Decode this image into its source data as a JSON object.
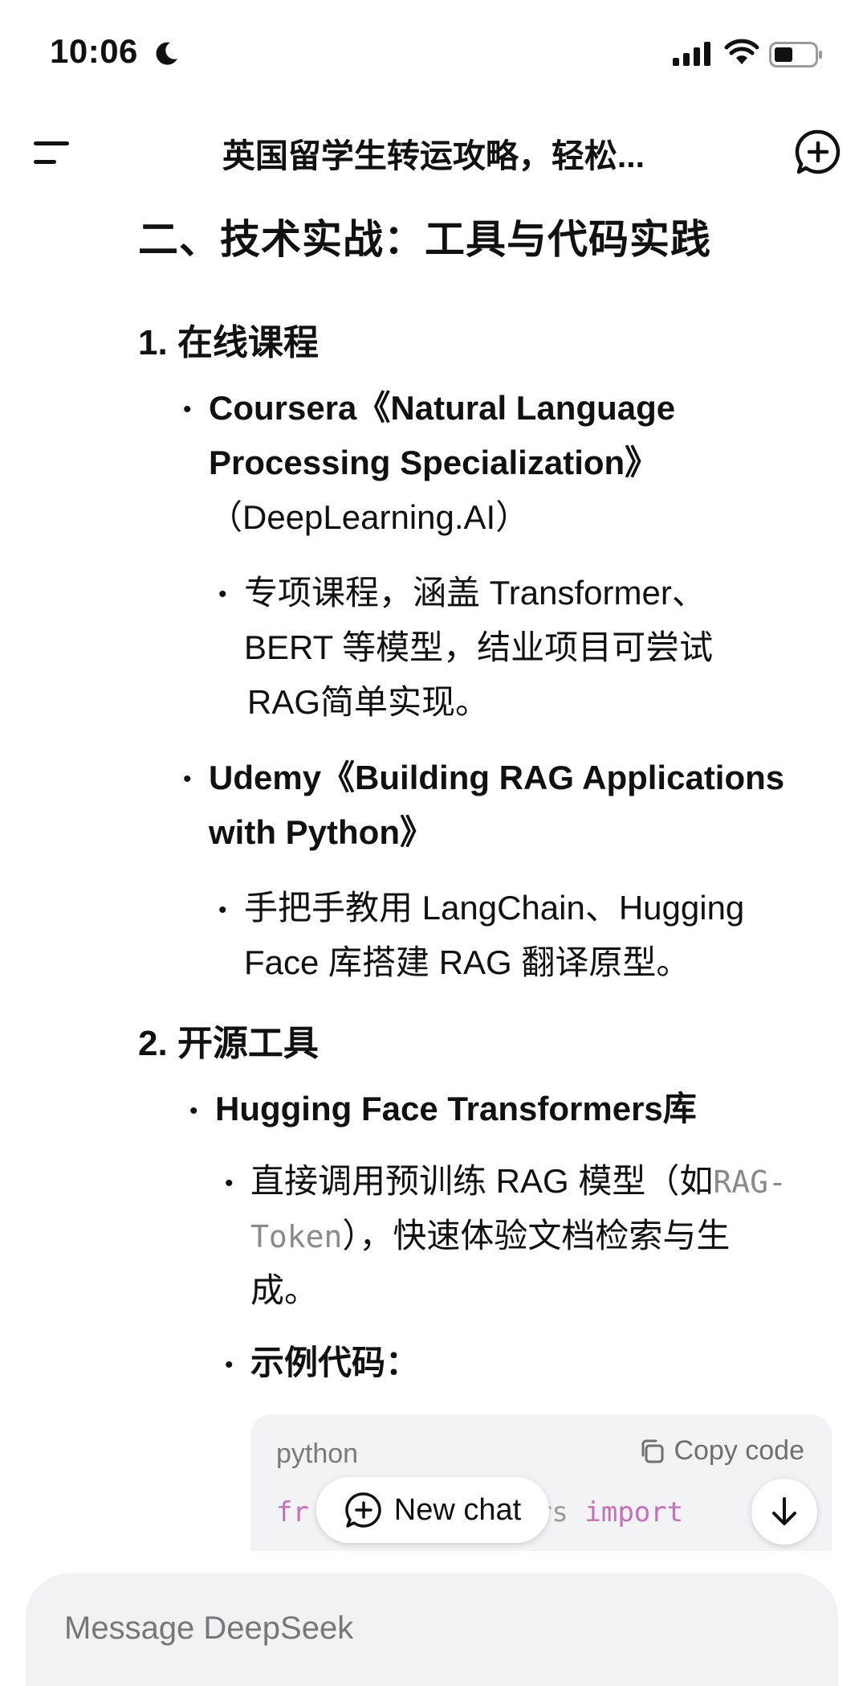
{
  "status_bar": {
    "time": "10:06"
  },
  "nav": {
    "title": "英国留学生转运攻略，轻松..."
  },
  "content": {
    "section_title": "二、技术实战：工具与代码实践",
    "list1": {
      "number": "1.",
      "title": "在线课程",
      "items": [
        {
          "title_line1": "Coursera《Natural Language",
          "title_line2": "Processing Specialization》",
          "subtitle": "（DeepLearning.AI）",
          "details": [
            {
              "lines": [
                "专项课程，涵盖 Transformer、",
                "BERT 等模型，结业项目可尝试",
                "RAG简单实现。"
              ]
            }
          ]
        },
        {
          "title_line1": "Udemy《Building RAG Applications",
          "title_line2": "with Python》",
          "details": [
            {
              "lines": [
                "手把手教用 LangChain、Hugging",
                "Face 库搭建 RAG 翻译原型。"
              ]
            }
          ]
        }
      ]
    },
    "list2": {
      "number": "2.",
      "title": "开源工具",
      "items": [
        {
          "title": "Hugging Face Transformers库",
          "detail1": {
            "line1_text": "直接调用预训练 RAG 模型（如",
            "line1_code": "RAG-",
            "line2_code": "Token",
            "line2_text": "），快速体验文档检索与生",
            "line3_text": "成。"
          },
          "detail2": "示例代码："
        }
      ]
    },
    "code_block": {
      "language": "python",
      "copy_label": "Copy code",
      "line1_a": "fr",
      "line1_b": "rs ",
      "line1_kw": "import"
    }
  },
  "new_chat_label": "New chat",
  "composer": {
    "placeholder": "Message DeepSeek"
  }
}
